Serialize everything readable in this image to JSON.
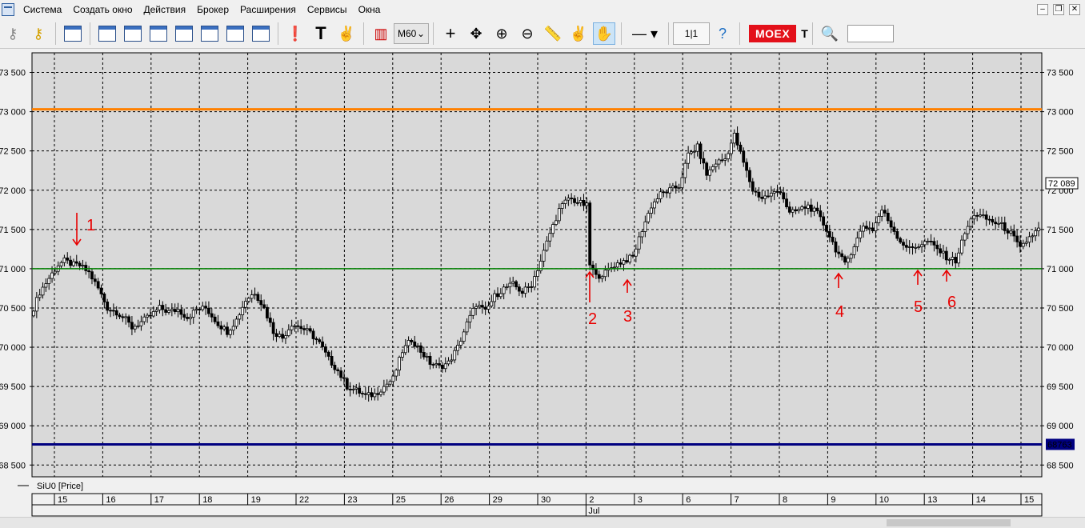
{
  "menu": [
    "Система",
    "Создать окно",
    "Действия",
    "Брокер",
    "Расширения",
    "Сервисы",
    "Окна"
  ],
  "toolbar": {
    "timeframe": "M60",
    "scale": "1|1",
    "exchange": "MOEX",
    "extra_text": "T"
  },
  "colors": {
    "orange_line": "#ff8000",
    "green_line": "#008000",
    "navy_line": "#000080",
    "candle": "#000000",
    "annotation": "#e80000",
    "chart_bg": "#d9d9d9"
  },
  "chart_data": {
    "type": "candlestick",
    "series_label": "SiU0 [Price]",
    "y_ticks": [
      68500,
      69000,
      69500,
      70000,
      70500,
      71000,
      71500,
      72000,
      72500,
      73000,
      73500
    ],
    "y_tick_labels": [
      "68 500",
      "69 000",
      "69 500",
      "70 000",
      "70 500",
      "71 000",
      "71 500",
      "72 000",
      "72 500",
      "73 000",
      "73 500"
    ],
    "ylim": [
      68350,
      73750
    ],
    "x_date_labels": [
      "15",
      "16",
      "17",
      "18",
      "19",
      "22",
      "23",
      "25",
      "26",
      "29",
      "30",
      "2",
      "3",
      "6",
      "7",
      "8",
      "9",
      "10",
      "13",
      "14",
      "15"
    ],
    "month_label": "Jul",
    "month_label_index": 11,
    "horizontal_lines": [
      {
        "value": 73030,
        "color": "#ff8000"
      },
      {
        "value": 71000,
        "color": "#008000"
      },
      {
        "value": 68763,
        "color": "#000080",
        "label": "68763"
      }
    ],
    "last_price": 72089,
    "last_price_label": "72 089",
    "annotations": [
      "1",
      "2",
      "3",
      "4",
      "5",
      "6"
    ],
    "close_path": [
      [
        0,
        70500
      ],
      [
        2,
        70700
      ],
      [
        5,
        70880
      ],
      [
        8,
        71050
      ],
      [
        10,
        71100
      ],
      [
        13,
        71050
      ],
      [
        15,
        71040
      ],
      [
        18,
        70950
      ],
      [
        21,
        70750
      ],
      [
        24,
        70500
      ],
      [
        27,
        70450
      ],
      [
        30,
        70350
      ],
      [
        32,
        70250
      ],
      [
        35,
        70320
      ],
      [
        38,
        70400
      ],
      [
        41,
        70500
      ],
      [
        44,
        70450
      ],
      [
        47,
        70480
      ],
      [
        50,
        70380
      ],
      [
        53,
        70480
      ],
      [
        56,
        70500
      ],
      [
        60,
        70300
      ],
      [
        63,
        70200
      ],
      [
        66,
        70350
      ],
      [
        69,
        70600
      ],
      [
        72,
        70700
      ],
      [
        75,
        70500
      ],
      [
        78,
        70200
      ],
      [
        81,
        70120
      ],
      [
        84,
        70300
      ],
      [
        87,
        70250
      ],
      [
        90,
        70180
      ],
      [
        93,
        70050
      ],
      [
        96,
        69850
      ],
      [
        99,
        69700
      ],
      [
        102,
        69500
      ],
      [
        105,
        69450
      ],
      [
        108,
        69380
      ],
      [
        111,
        69400
      ],
      [
        114,
        69500
      ],
      [
        117,
        69600
      ],
      [
        120,
        69950
      ],
      [
        123,
        70100
      ],
      [
        126,
        69950
      ],
      [
        129,
        69800
      ],
      [
        132,
        69750
      ],
      [
        135,
        69800
      ],
      [
        138,
        70000
      ],
      [
        141,
        70300
      ],
      [
        144,
        70550
      ],
      [
        147,
        70450
      ],
      [
        150,
        70650
      ],
      [
        153,
        70750
      ],
      [
        156,
        70800
      ],
      [
        159,
        70700
      ],
      [
        162,
        70800
      ],
      [
        165,
        71100
      ],
      [
        168,
        71450
      ],
      [
        171,
        71750
      ],
      [
        174,
        71900
      ],
      [
        177,
        71850
      ],
      [
        180,
        71800
      ],
      [
        181,
        71050
      ],
      [
        183,
        70900
      ],
      [
        186,
        70950
      ],
      [
        189,
        71050
      ],
      [
        192,
        71100
      ],
      [
        195,
        71150
      ],
      [
        198,
        71500
      ],
      [
        201,
        71800
      ],
      [
        204,
        71950
      ],
      [
        207,
        72000
      ],
      [
        210,
        72050
      ],
      [
        213,
        72450
      ],
      [
        216,
        72550
      ],
      [
        219,
        72200
      ],
      [
        222,
        72350
      ],
      [
        225,
        72400
      ],
      [
        228,
        72700
      ],
      [
        231,
        72350
      ],
      [
        234,
        72000
      ],
      [
        237,
        71900
      ],
      [
        240,
        71950
      ],
      [
        243,
        72000
      ],
      [
        246,
        71700
      ],
      [
        249,
        71750
      ],
      [
        252,
        71800
      ],
      [
        255,
        71700
      ],
      [
        258,
        71500
      ],
      [
        261,
        71250
      ],
      [
        264,
        71050
      ],
      [
        267,
        71300
      ],
      [
        270,
        71550
      ],
      [
        273,
        71500
      ],
      [
        276,
        71750
      ],
      [
        279,
        71550
      ],
      [
        282,
        71350
      ],
      [
        285,
        71250
      ],
      [
        288,
        71300
      ],
      [
        291,
        71350
      ],
      [
        294,
        71250
      ],
      [
        297,
        71150
      ],
      [
        300,
        71100
      ],
      [
        303,
        71450
      ],
      [
        306,
        71700
      ],
      [
        309,
        71650
      ],
      [
        312,
        71600
      ],
      [
        315,
        71550
      ],
      [
        318,
        71450
      ],
      [
        321,
        71250
      ],
      [
        324,
        71400
      ],
      [
        327,
        71500
      ]
    ]
  }
}
